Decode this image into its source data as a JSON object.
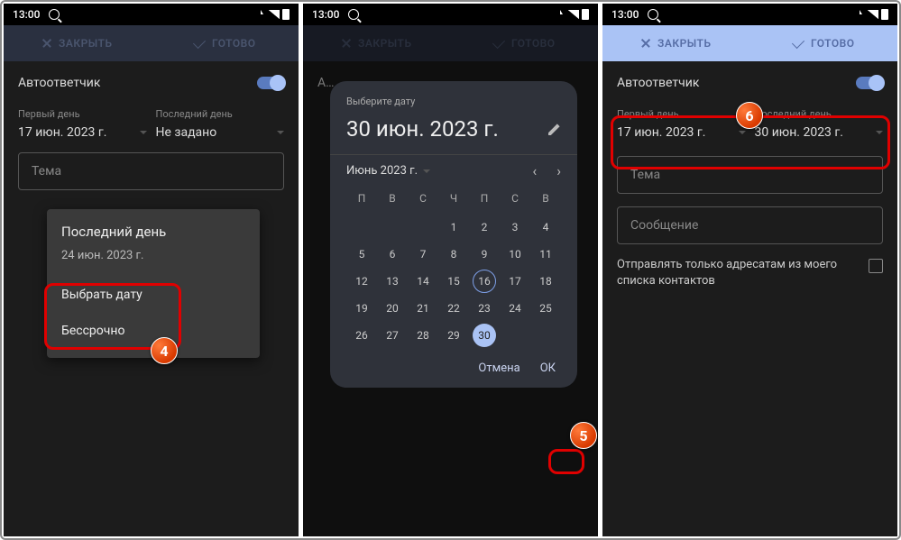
{
  "statusbar": {
    "time": "13:00"
  },
  "topbar": {
    "close": "ЗАКРЫТЬ",
    "done": "ГОТОВО"
  },
  "toggle_label": "Автоответчик",
  "date_labels": {
    "first": "Первый день",
    "last": "Последний день"
  },
  "panel1": {
    "first_date": "17 июн. 2023 г.",
    "last_date": "Не задано",
    "subject_ph": "Тема",
    "popup_title": "Последний день",
    "popup_sub": "24 июн. 2023 г.",
    "popup_opt1": "Выбрать дату",
    "popup_opt2": "Бессрочно"
  },
  "panel2": {
    "dialog_small": "Выберите дату",
    "dialog_date": "30 июн. 2023 г.",
    "month_label": "Июнь 2023 г.",
    "dow": [
      "П",
      "В",
      "С",
      "Ч",
      "П",
      "С",
      "В"
    ],
    "weeks": [
      [
        "",
        "",
        "",
        "1",
        "2",
        "3",
        "4"
      ],
      [
        "5",
        "6",
        "7",
        "8",
        "9",
        "10",
        "11"
      ],
      [
        "12",
        "13",
        "14",
        "15",
        "16",
        "17",
        "18"
      ],
      [
        "19",
        "20",
        "21",
        "22",
        "23",
        "24",
        "25"
      ],
      [
        "26",
        "27",
        "28",
        "29",
        "30",
        "",
        ""
      ]
    ],
    "today_cell": "16",
    "selected_cell": "30",
    "cancel": "Отмена",
    "ok": "ОК"
  },
  "panel3": {
    "first_date": "17 июн. 2023 г.",
    "last_date": "30 июн. 2023 г.",
    "subject_ph": "Тема",
    "message_ph": "Сообщение",
    "only_contacts": "Отправлять только адресатам из моего списка контактов"
  },
  "badges": {
    "b4": "4",
    "b5": "5",
    "b6": "6"
  }
}
